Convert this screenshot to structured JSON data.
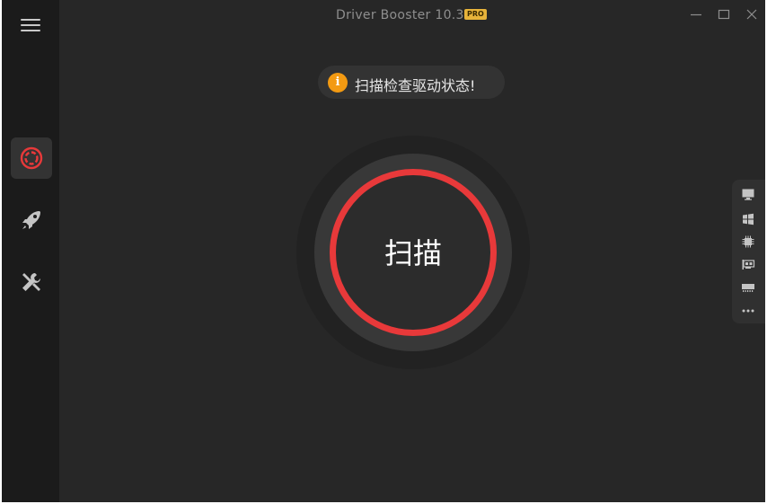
{
  "window": {
    "title": "Driver Booster 10.3",
    "badge": "PRO"
  },
  "sidebar": {
    "items": [
      {
        "name": "scan",
        "icon": "target-scan-icon",
        "active": true
      },
      {
        "name": "boost",
        "icon": "rocket-icon",
        "active": false
      },
      {
        "name": "tools",
        "icon": "tools-icon",
        "active": false
      }
    ]
  },
  "status": {
    "icon_text": "i",
    "message": "扫描检查驱动状态!"
  },
  "scan_button": {
    "label": "扫描"
  },
  "device_panel": {
    "icons": [
      "monitor-icon",
      "windows-icon",
      "chip-icon",
      "network-card-icon",
      "memory-icon",
      "more-icon"
    ]
  },
  "colors": {
    "accent": "#e8393a",
    "info": "#f39a12",
    "badge": "#e7b33a",
    "background": "#272727",
    "sidebar": "#1b1b1b"
  }
}
